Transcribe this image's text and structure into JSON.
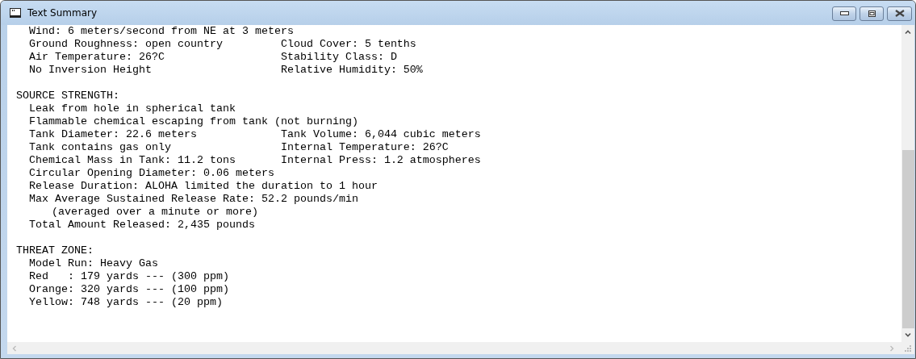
{
  "window": {
    "title": "Text Summary"
  },
  "sections": [
    {
      "lines": [
        {
          "left": "Wind: 6 meters/second from NE at 3 meters"
        },
        {
          "left": "Ground Roughness: open country",
          "right": "Cloud Cover: 5 tenths"
        },
        {
          "left": "Air Temperature: 26?C",
          "right": "Stability Class: D"
        },
        {
          "left": "No Inversion Height",
          "right": "Relative Humidity: 50%"
        }
      ]
    },
    {
      "heading": "SOURCE STRENGTH:",
      "lines": [
        {
          "left": "Leak from hole in spherical tank"
        },
        {
          "left": "Flammable chemical escaping from tank (not burning)"
        },
        {
          "left": "Tank Diameter: 22.6 meters",
          "right": "Tank Volume: 6,044 cubic meters"
        },
        {
          "left": "Tank contains gas only",
          "right": "Internal Temperature: 26?C"
        },
        {
          "left": "Chemical Mass in Tank: 11.2 tons",
          "right": "Internal Press: 1.2 atmospheres"
        },
        {
          "left": "Circular Opening Diameter: 0.06 meters"
        },
        {
          "left": "Release Duration: ALOHA limited the duration to 1 hour"
        },
        {
          "left": "Max Average Sustained Release Rate: 52.2 pounds/min",
          "children": [
            {
              "left": "(averaged over a minute or more)"
            }
          ]
        },
        {
          "left": "Total Amount Released: 2,435 pounds"
        }
      ]
    },
    {
      "heading": "THREAT ZONE:",
      "lines": [
        {
          "left": "Model Run: Heavy Gas"
        },
        {
          "left": "Red   : 179 yards --- (300 ppm)"
        },
        {
          "left": "Orange: 320 yards --- (100 ppm)"
        },
        {
          "left": "Yellow: 748 yards --- (20 ppm)"
        }
      ]
    }
  ]
}
